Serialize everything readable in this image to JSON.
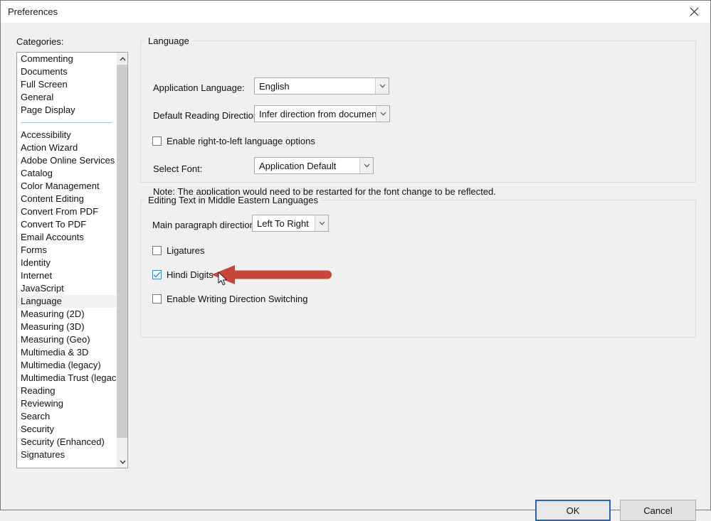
{
  "window": {
    "title": "Preferences",
    "close_icon": "close-icon"
  },
  "sidebar": {
    "label": "Categories:",
    "items_top": [
      {
        "label": "Commenting"
      },
      {
        "label": "Documents"
      },
      {
        "label": "Full Screen"
      },
      {
        "label": "General"
      },
      {
        "label": "Page Display"
      }
    ],
    "items_bottom": [
      {
        "label": "Accessibility"
      },
      {
        "label": "Action Wizard"
      },
      {
        "label": "Adobe Online Services"
      },
      {
        "label": "Catalog"
      },
      {
        "label": "Color Management"
      },
      {
        "label": "Content Editing"
      },
      {
        "label": "Convert From PDF"
      },
      {
        "label": "Convert To PDF"
      },
      {
        "label": "Email Accounts"
      },
      {
        "label": "Forms"
      },
      {
        "label": "Identity"
      },
      {
        "label": "Internet"
      },
      {
        "label": "JavaScript"
      },
      {
        "label": "Language"
      },
      {
        "label": "Measuring (2D)"
      },
      {
        "label": "Measuring (3D)"
      },
      {
        "label": "Measuring (Geo)"
      },
      {
        "label": "Multimedia & 3D"
      },
      {
        "label": "Multimedia (legacy)"
      },
      {
        "label": "Multimedia Trust (legacy)"
      },
      {
        "label": "Reading"
      },
      {
        "label": "Reviewing"
      },
      {
        "label": "Search"
      },
      {
        "label": "Security"
      },
      {
        "label": "Security (Enhanced)"
      },
      {
        "label": "Signatures"
      }
    ],
    "selected": "Language"
  },
  "language_group": {
    "title": "Language",
    "application_language": {
      "label": "Application Language:",
      "value": "English"
    },
    "default_reading_direction": {
      "label": "Default Reading Direction:",
      "value": "Infer direction from document"
    },
    "rtl_checkbox": {
      "label": "Enable right-to-left language options",
      "checked": false
    },
    "select_font": {
      "label": "Select Font:",
      "value": "Application Default"
    },
    "note": "Note: The application would need to be restarted for the font change to be reflected."
  },
  "middle_east_group": {
    "title": "Editing Text in Middle Eastern Languages",
    "main_paragraph_direction": {
      "label": "Main paragraph direction:",
      "value": "Left To Right"
    },
    "ligatures": {
      "label": "Ligatures",
      "checked": false
    },
    "hindi_digits": {
      "label": "Hindi Digits",
      "checked": true
    },
    "writing_direction_switching": {
      "label": "Enable Writing Direction Switching",
      "checked": false
    }
  },
  "footer": {
    "ok_label": "OK",
    "cancel_label": "Cancel"
  },
  "annotation": {
    "arrow_color": "#c8453a",
    "arrow_direction": "left",
    "points_at": "Hindi Digits"
  },
  "colors": {
    "dialog_background": "#f0f0f0",
    "accent_focus": "#2a63b5",
    "checkbox_checked": "#3a86d4",
    "separator": "#a8c3e6"
  }
}
